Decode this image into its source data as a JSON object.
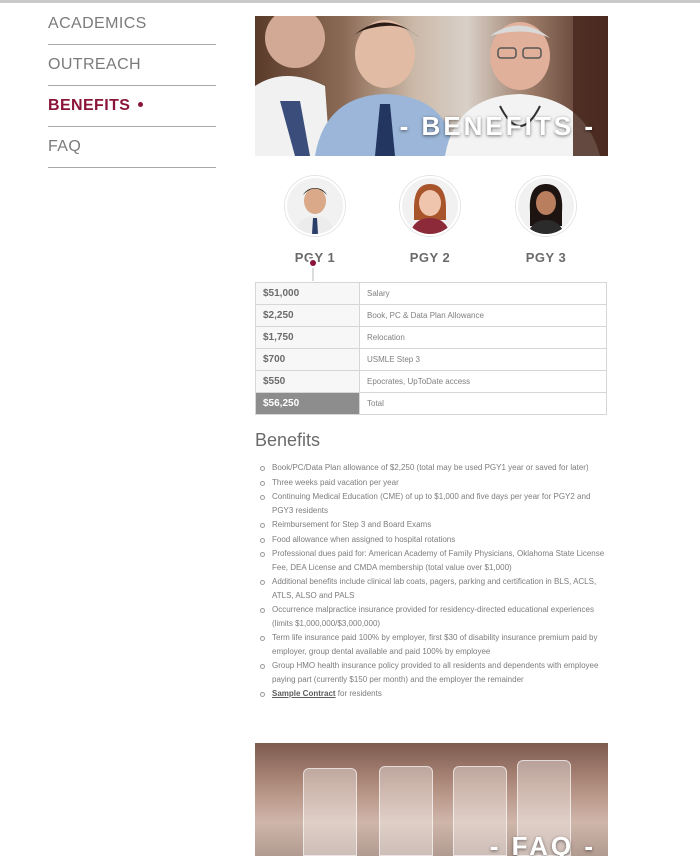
{
  "nav": {
    "items": [
      {
        "label": "ACADEMICS"
      },
      {
        "label": "OUTREACH"
      },
      {
        "label": "BENEFITS"
      },
      {
        "label": "FAQ"
      }
    ],
    "active_index": 2
  },
  "hero": {
    "title": "- BENEFITS -"
  },
  "pgy": {
    "options": [
      {
        "label": "PGY 1",
        "avatar": "resident-avatar-1"
      },
      {
        "label": "PGY 2",
        "avatar": "resident-avatar-2"
      },
      {
        "label": "PGY 3",
        "avatar": "resident-avatar-3"
      }
    ],
    "selected": "PGY 1"
  },
  "salary_table": {
    "rows": [
      {
        "amount": "$51,000",
        "label": "Salary"
      },
      {
        "amount": "$2,250",
        "label": "Book, PC & Data Plan Allowance"
      },
      {
        "amount": "$1,750",
        "label": "Relocation"
      },
      {
        "amount": "$700",
        "label": "USMLE Step 3"
      },
      {
        "amount": "$550",
        "label": "Epocrates, UpToDate access"
      }
    ],
    "total": {
      "amount": "$56,250",
      "label": "Total"
    }
  },
  "benefits": {
    "heading": "Benefits",
    "items": [
      "Book/PC/Data Plan allowance of $2,250 (total may be used PGY1 year or saved for later)",
      "Three weeks paid vacation per year",
      "Continuing Medical Education (CME) of up to $1,000 and five days per year for PGY2 and PGY3 residents",
      "Reimbursement for Step 3 and Board Exams",
      "Food allowance when assigned to hospital rotations",
      "Professional dues paid for: American Academy of Family Physicians, Oklahoma State License Fee, DEA License and CMDA membership (total value over $1,000)",
      "Additional benefits include clinical lab coats, pagers, parking and certification in BLS, ACLS, ATLS, ALSO and PALS",
      "Occurrence malpractice insurance provided for residency-directed educational experiences (limits $1,000,000/$3,000,000)",
      "Term life insurance paid 100% by employer, first $30 of disability insurance premium paid by employer, group dental available and paid 100% by employee",
      "Group HMO health insurance policy provided to all residents and dependents with employee paying part (currently $150 per month) and the employer the remainder"
    ],
    "contract_link": "Sample Contract",
    "contract_suffix": " for residents"
  },
  "faq_banner": {
    "title": "- FAQ -"
  },
  "colors": {
    "accent": "#8a1538",
    "text": "#7b7b7b",
    "total_bg": "#8d8d8d"
  }
}
